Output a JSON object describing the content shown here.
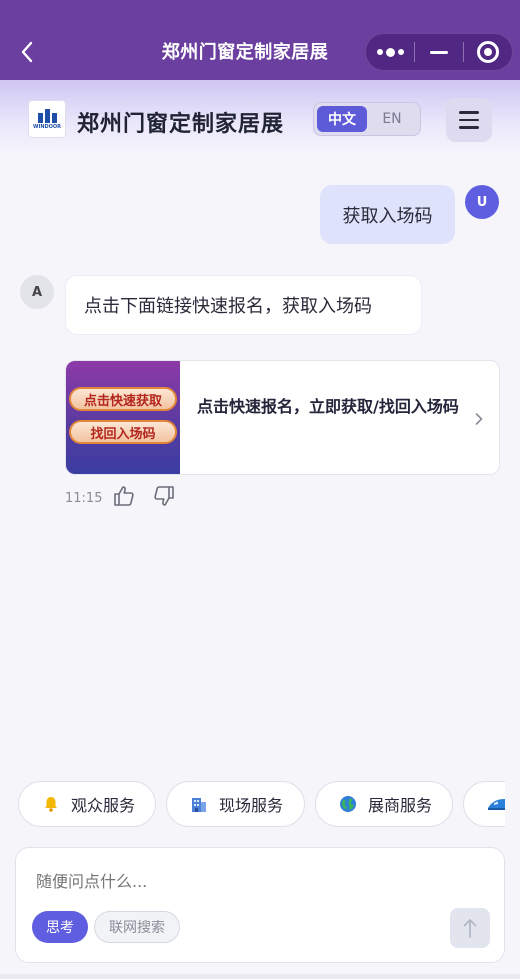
{
  "topbar": {
    "title": "郑州门窗定制家居展",
    "back_icon": "chevron-left-icon",
    "capsule": [
      "more-dots-icon",
      "minimize-icon",
      "close-target-icon"
    ]
  },
  "brand": {
    "name": "郑州门窗定制家居展",
    "logo_text": "WINDOOR",
    "lang_options": [
      "中文",
      "EN"
    ],
    "lang_selected": "中文",
    "menu_icon": "hamburger-menu-icon"
  },
  "colors": {
    "accent": "#5f5ee0",
    "topbar": "#6b3fa0"
  },
  "conversation": {
    "user_avatar": "U",
    "user_message": "获取入场码",
    "bot_avatar": "A",
    "bot_message": "点击下面链接快速报名，获取入场码",
    "link_card": {
      "thumb_lines": [
        "点击快速获取",
        "找回入场码"
      ],
      "text": "点击快速报名，立即获取/找回入场码"
    },
    "time": "11:15"
  },
  "quick_services": [
    {
      "icon": "bell-icon",
      "label": "观众服务"
    },
    {
      "icon": "building-icon",
      "label": "现场服务"
    },
    {
      "icon": "globe-icon",
      "label": "展商服务"
    },
    {
      "icon": "train-icon",
      "label": ""
    }
  ],
  "composer": {
    "placeholder": "随便问点什么...",
    "think_label": "思考",
    "web_search_label": "联网搜索",
    "send_icon": "arrow-up-icon"
  }
}
